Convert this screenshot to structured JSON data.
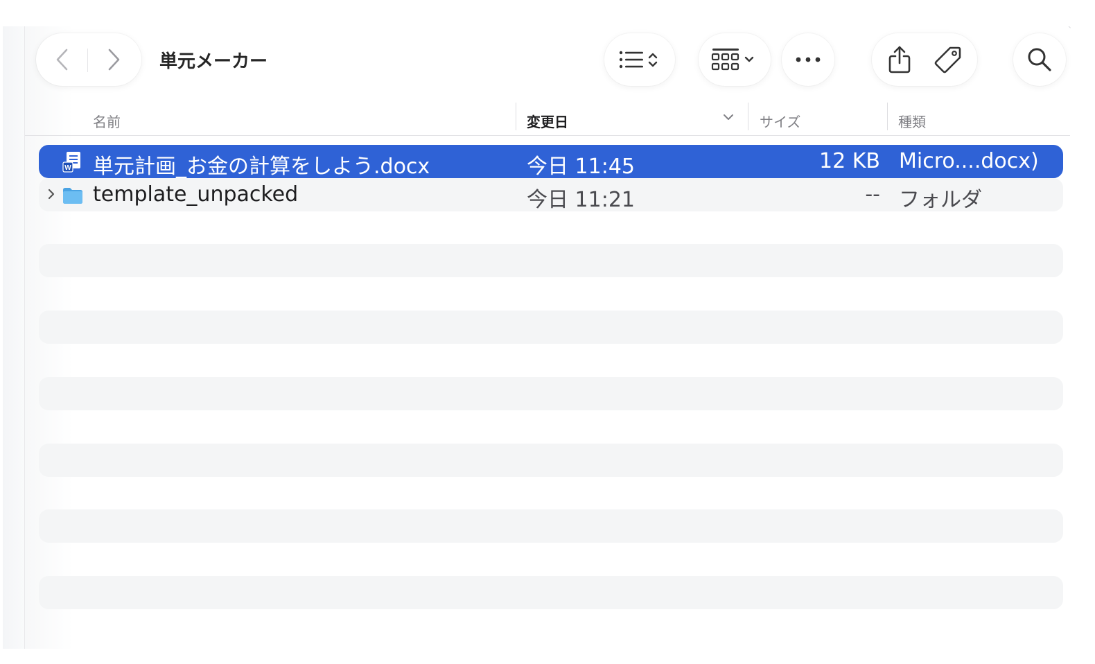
{
  "window": {
    "title": "単元メーカー"
  },
  "columns": {
    "name": "名前",
    "date": "変更日",
    "size": "サイズ",
    "kind": "種類"
  },
  "files": [
    {
      "name": "単元計画_お金の計算をしよう.docx",
      "date": "今日 11:45",
      "size": "12 KB",
      "kind": "Micro....docx)",
      "icon": "word-document-icon",
      "selected": true
    },
    {
      "name": "template_unpacked",
      "date": "今日 11:21",
      "size": "--",
      "kind": "フォルダ",
      "icon": "folder-icon",
      "selected": false
    }
  ],
  "colors": {
    "selection": "#2f62d6",
    "folder": "#5fb3ec",
    "stripe": "#f4f5f6"
  }
}
